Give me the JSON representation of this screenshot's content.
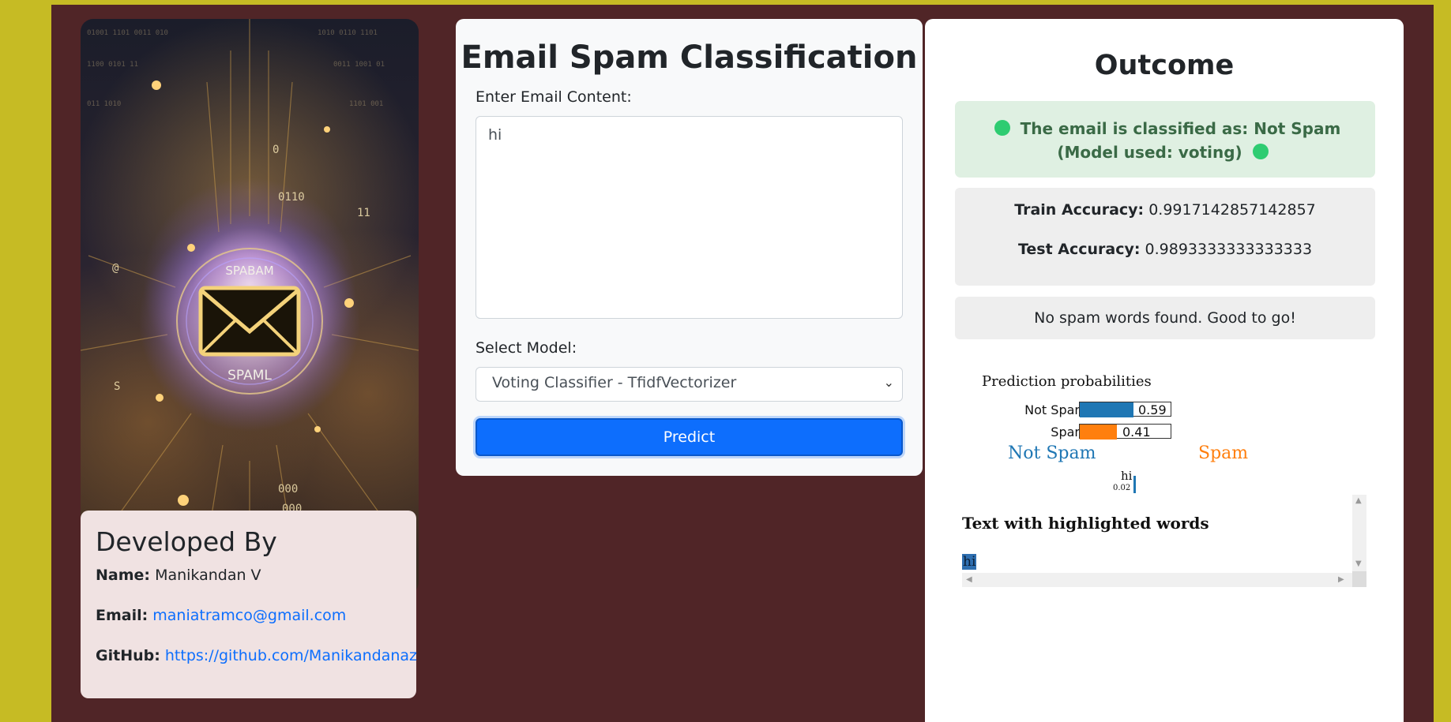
{
  "profile": {
    "image_text_top": "SPABAM",
    "image_text_bottom": "SPAML",
    "heading": "Developed By",
    "name_label": "Name:",
    "name_value": "Manikandan V",
    "email_label": "Email:",
    "email_value": "maniatramco@gmail.com",
    "github_label": "GitHub:",
    "github_value": "https://github.com/Manikandanaz"
  },
  "form": {
    "title": "Email Spam Classification",
    "content_label": "Enter Email Content:",
    "content_value": "hi",
    "model_label": "Select Model:",
    "model_selected": "Voting Classifier - TfidfVectorizer",
    "predict_label": "Predict"
  },
  "outcome": {
    "title": "Outcome",
    "result_prefix": "The email is classified as:",
    "result_value": "Not Spam",
    "result_suffix": "(Model used: voting)",
    "train_label": "Train Accuracy:",
    "train_value": "0.9917142857142857",
    "test_label": "Test Accuracy:",
    "test_value": "0.9893333333333333",
    "spam_words_message": "No spam words found. Good to go!",
    "status_dot_color": "#2ecc71"
  },
  "lime": {
    "probabilities_title": "Prediction probabilities",
    "classes": [
      {
        "label": "Not Spam",
        "value": 0.59,
        "display": "0.59",
        "color": "#1f77b4"
      },
      {
        "label": "Spam",
        "value": 0.41,
        "display": "0.41",
        "color": "#ff7f0e"
      }
    ],
    "left_class": "Not Spam",
    "right_class": "Spam",
    "feature_word": "hi",
    "feature_weight": "0.02",
    "highlight_title": "Text with highlighted words",
    "highlighted_text": "hi"
  }
}
